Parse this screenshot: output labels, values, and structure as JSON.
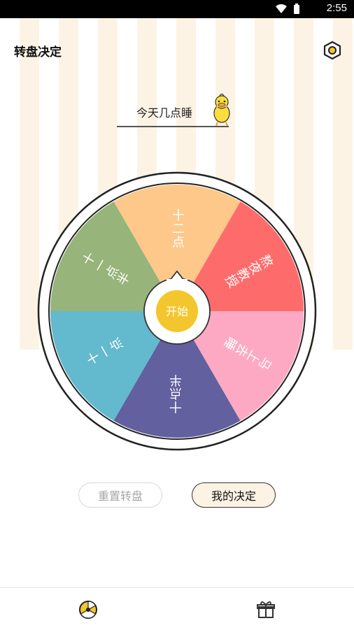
{
  "status_bar": {
    "time": "2:55",
    "icons": [
      "wifi-icon",
      "battery-icon"
    ]
  },
  "header": {
    "title": "转盘决定",
    "settings_icon": "settings-icon"
  },
  "topic": {
    "text": "今天几点睡"
  },
  "wheel": {
    "segments": [
      {
        "label": "十二点",
        "color": "#fdc88a"
      },
      {
        "label": "熬夜教授",
        "color": "#fe6b6b"
      },
      {
        "label": "马上去睡",
        "color": "#fda9c3"
      },
      {
        "label": "十点半",
        "color": "#62609f"
      },
      {
        "label": "十一点",
        "color": "#63b9ce"
      },
      {
        "label": "十一点半",
        "color": "#97b47a"
      }
    ],
    "start_label": "开始",
    "start_color": "#f4c62d"
  },
  "buttons": {
    "reset": "重置转盘",
    "decide": "我的决定"
  },
  "nav": {
    "items": [
      "wheel-icon",
      "gift-icon"
    ]
  }
}
